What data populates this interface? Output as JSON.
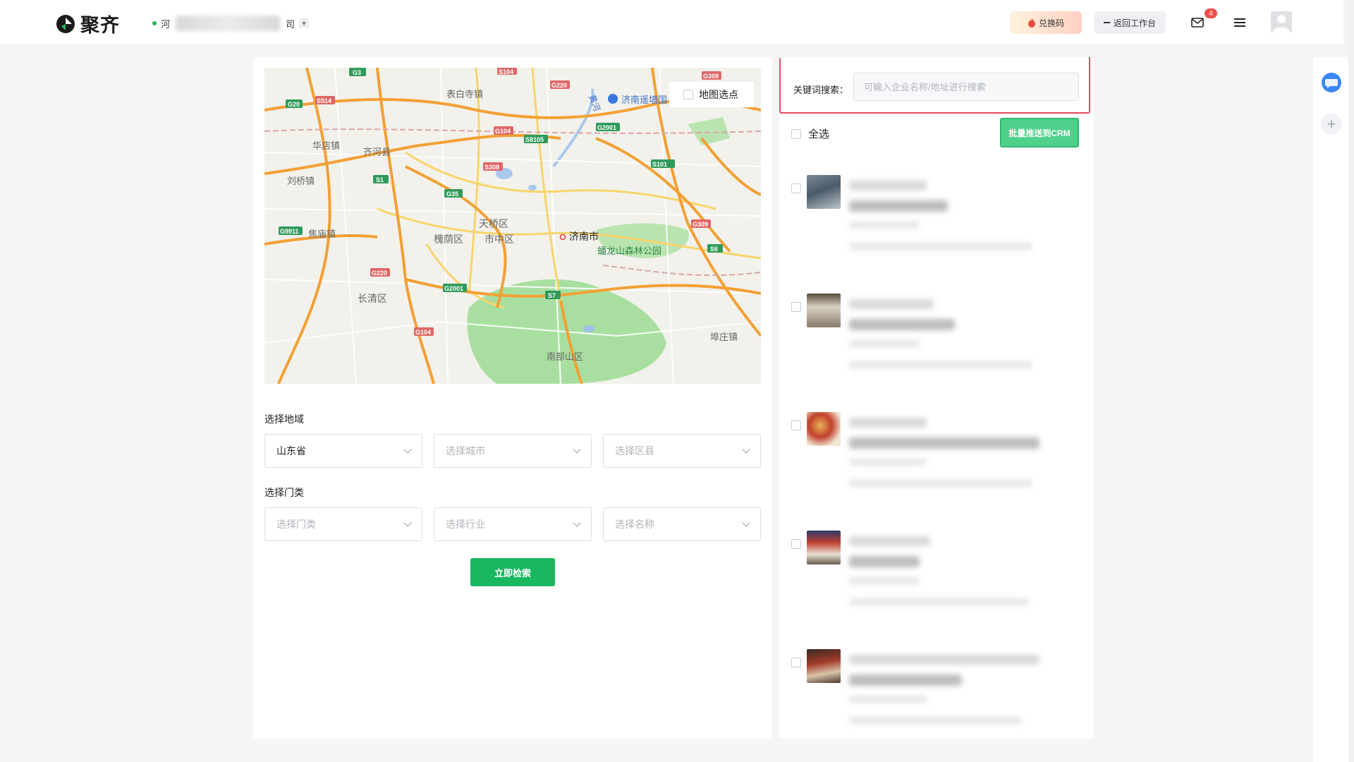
{
  "header": {
    "logo_text": "聚齐",
    "company_prefix": "河",
    "company_suffix": "司",
    "exchange_label": "兑换码",
    "back_label": "返回工作台",
    "mail_badge": "4"
  },
  "map": {
    "pick_label": "地图选点",
    "labels": [
      "表白寺镇",
      "华店镇",
      "齐河县",
      "刘桥镇",
      "焦庙镇",
      "长清区",
      "槐荫区",
      "市中区",
      "天桥区",
      "济南市",
      "蟠龙山森林公园",
      "南部山区",
      "埠庄镇",
      "济南遥墙国",
      "黄河"
    ],
    "shields": [
      "G3",
      "G20",
      "S514",
      "G220",
      "G104",
      "G309",
      "S104",
      "G2001",
      "S1",
      "G35",
      "S8105",
      "S308",
      "S101",
      "G309",
      "S6",
      "G9911",
      "G220",
      "G2001",
      "S7",
      "G104"
    ]
  },
  "filters": {
    "region_label": "选择地域",
    "province": "山东省",
    "city_placeholder": "选择城市",
    "district_placeholder": "选择区县",
    "category_label": "选择门类",
    "category_placeholder": "选择门类",
    "industry_placeholder": "选择行业",
    "name_placeholder": "选择名称",
    "search_button": "立即检索"
  },
  "results": {
    "keyword_label": "关键词搜索：",
    "keyword_placeholder": "可输入企业名称/地址进行搜索",
    "select_all": "全选",
    "crm_button": "批量推送到CRM"
  }
}
